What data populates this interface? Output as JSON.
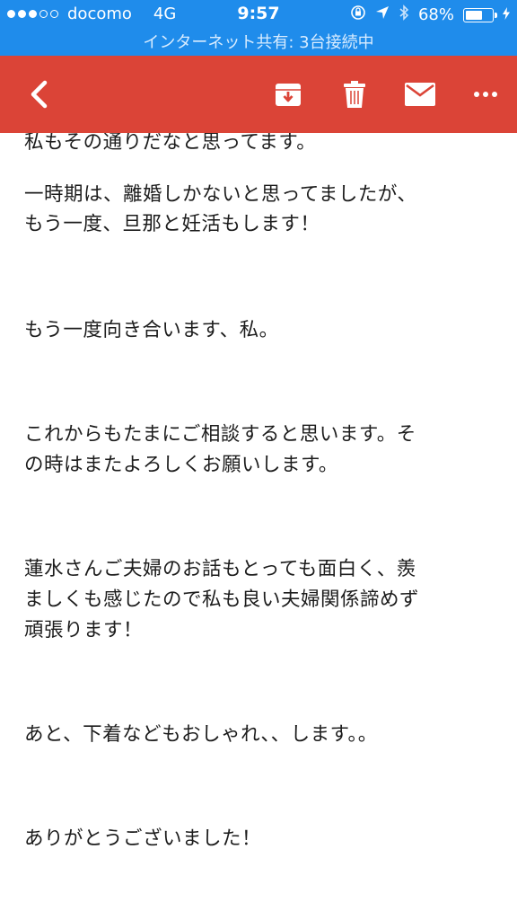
{
  "status_bar": {
    "carrier": "docomo",
    "network": "4G",
    "time": "9:57",
    "battery": "68%",
    "battery_level": 0.68,
    "hotspot": "インターネット共有: 3台接続中"
  },
  "toolbar": {
    "color": "#db4437"
  },
  "message": {
    "lines": [
      "私もその通りだなと思ってます。",
      "一時期は、離婚しかないと思ってましたが、",
      "もう一度、旦那と妊活もします！",
      "もう一度向き合います、私。",
      "これからもたまにご相談すると思います。そ",
      "の時はまたよろしくお願いします。",
      "蓮水さんご夫婦のお話もとっても面白く、羨",
      "ましくも感じたので私も良い夫婦関係諦めず",
      "頑張ります！",
      "あと、下着などもおしゃれ、、します。。",
      "ありがとうございました！"
    ]
  }
}
